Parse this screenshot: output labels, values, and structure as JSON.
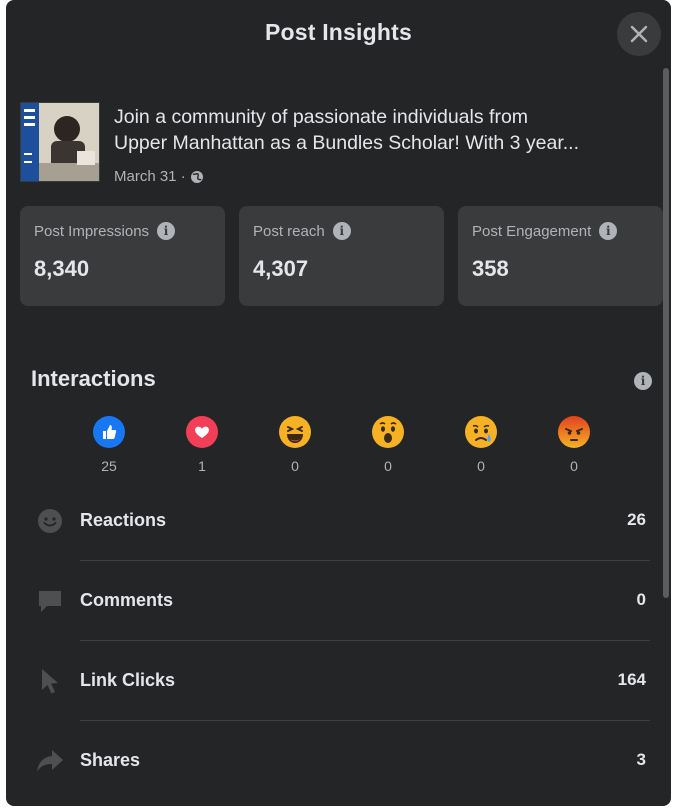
{
  "modal": {
    "title": "Post Insights"
  },
  "post": {
    "text_line1": "Join a community of passionate individuals from",
    "text_line2": "Upper Manhattan as a Bundles Scholar! With 3 year...",
    "date": "March 31 ·",
    "privacy_icon": "globe-icon"
  },
  "metrics": [
    {
      "label": "Post Impressions",
      "value": "8,340"
    },
    {
      "label": "Post reach",
      "value": "4,307"
    },
    {
      "label": "Post Engagement",
      "value": "358"
    }
  ],
  "interactions": {
    "title": "Interactions",
    "reactions": [
      {
        "type": "like",
        "icon": "like-icon",
        "color": "#1877f2",
        "count": "25"
      },
      {
        "type": "love",
        "icon": "love-icon",
        "color": "#f33e58",
        "count": "1"
      },
      {
        "type": "haha",
        "icon": "haha-icon",
        "color": "#f7b125",
        "count": "0"
      },
      {
        "type": "wow",
        "icon": "wow-icon",
        "color": "#f7b125",
        "count": "0"
      },
      {
        "type": "sad",
        "icon": "sad-icon",
        "color": "#f7b125",
        "count": "0"
      },
      {
        "type": "angry",
        "icon": "angry-icon",
        "color": "#e9710f",
        "count": "0"
      }
    ],
    "rows": [
      {
        "label": "Reactions",
        "icon": "reactions-icon",
        "value": "26"
      },
      {
        "label": "Comments",
        "icon": "comment-icon",
        "value": "0"
      },
      {
        "label": "Link Clicks",
        "icon": "cursor-icon",
        "value": "164"
      },
      {
        "label": "Shares",
        "icon": "share-icon",
        "value": "3"
      }
    ]
  },
  "colors": {
    "background": "#242526",
    "card": "#3a3b3c",
    "text_primary": "#e4e6eb",
    "text_secondary": "#b0b3b8"
  }
}
